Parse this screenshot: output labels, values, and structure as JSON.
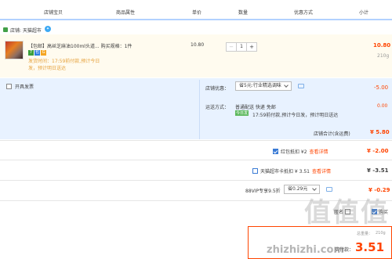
{
  "columns": [
    "店铺宝贝",
    "商品属性",
    "单价",
    "数量",
    "优惠方式",
    "小计"
  ],
  "shop": {
    "label": "店铺: 天猫超市"
  },
  "item": {
    "title": "【包邮】高丝芝麻油100ml头道... 购买规格：1件",
    "tags": [
      "7",
      "包",
      "G"
    ],
    "delivery": "发货时间：17:59前付款,预计今日",
    "delivery2": "发，预计明日送达",
    "unit_price": "10.80",
    "quantity": "1",
    "subtotal": "10.80",
    "weight": "210g"
  },
  "invoice": {
    "label": "开具发票"
  },
  "shop_discount": {
    "label": "店铺优惠：",
    "selected": "省5元:行业精选调味",
    "amount": "-5.00"
  },
  "shipping": {
    "label": "运送方式：",
    "method": "普通配送 快递 免邮",
    "badge": "今日发",
    "eta": "17:59前付款,预计今日发，预计明日送达",
    "amount": "0.00"
  },
  "shop_total": {
    "label": "店铺合计(含运费)",
    "amount": "¥ 5.80"
  },
  "red_packet": {
    "label": "红包抵扣 ¥2",
    "link": "查看详情",
    "amount": "¥ -2.00",
    "checked": true
  },
  "tmall_card": {
    "label": "天猫超市卡抵扣 ¥ 3.51",
    "link": "查看详情",
    "amount": "¥ -3.51",
    "checked": false
  },
  "vip": {
    "label": "88VIP专享9.5折",
    "selected": "省0.29元",
    "amount": "¥ -0.29"
  },
  "footer": {
    "anon_label": "匿名",
    "buy_label": "购买",
    "weight_label": "总重量：",
    "weight": "210g",
    "pay_label": "实付款：",
    "pay_amount": "3.51"
  },
  "colors": {
    "accent": "#ff4400",
    "promo_bg": "#e8f2ff",
    "item_bg": "#fffbef"
  }
}
